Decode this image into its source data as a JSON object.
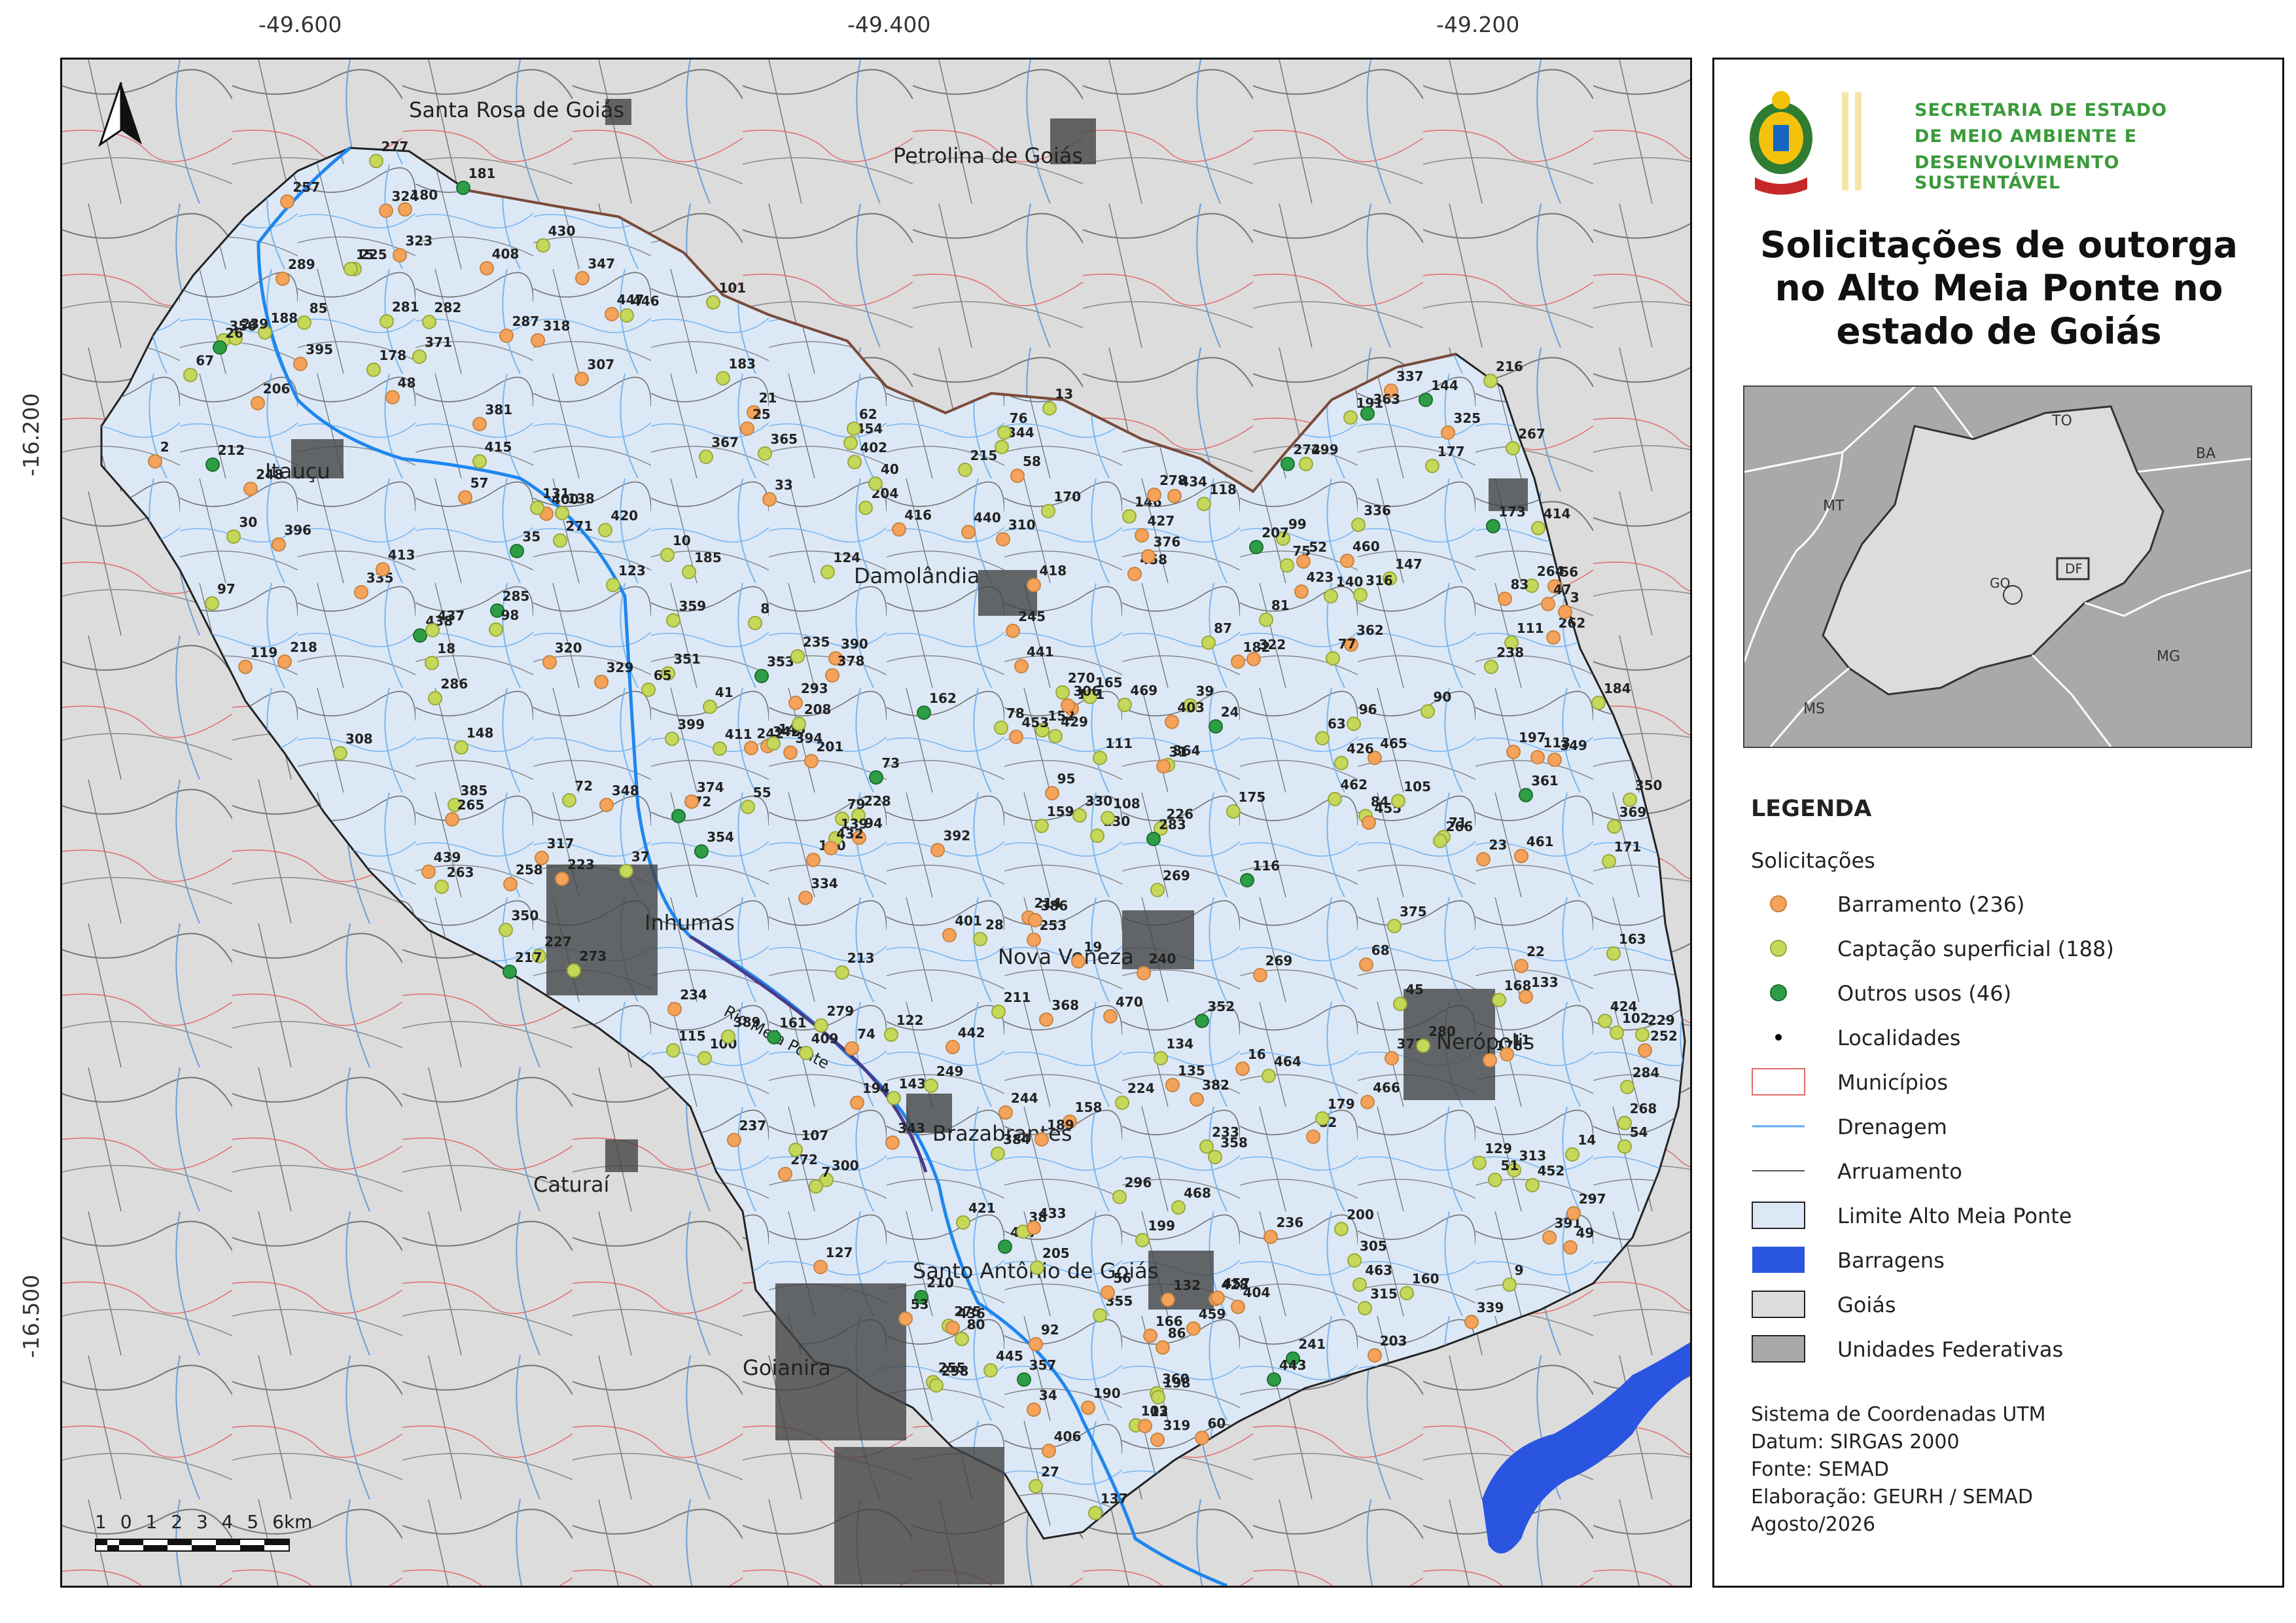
{
  "map": {
    "longitude_ticks": [
      "-49.600",
      "-49.400",
      "-49.200"
    ],
    "latitude_ticks": [
      "-16.200",
      "-16.500"
    ],
    "north_arrow": "north-arrow-icon",
    "scale_bar": {
      "labels": [
        "1",
        "0",
        "1",
        "2",
        "3",
        "4",
        "5",
        "6"
      ],
      "unit": "km"
    },
    "river_label": "Rio Meia Ponte",
    "localities": [
      "Santa Rosa de Goiás",
      "Petrolina de Goiás",
      "Itauçu",
      "Damolândia",
      "Inhumas",
      "Nova Veneza",
      "Nerópolis",
      "Brazabrantes",
      "Caturaí",
      "Santo Antônio de Goiás",
      "Goianira"
    ],
    "colors": {
      "barramento": "#f5a25a",
      "captacao_superficial": "#c6d85a",
      "outros_usos": "#2e9e46",
      "basin_fill": "#dce8f5",
      "outside_fill": "#dcdcdc",
      "drainage": "#5fa8f0",
      "reservoir": "#2a55e0",
      "municipal_border": "#e36a6a"
    }
  },
  "org": {
    "line1": "SECRETARIA DE ESTADO",
    "line2": "DE MEIO AMBIENTE E",
    "line3": "DESENVOLVIMENTO SUSTENTÁVEL",
    "emblem": "goias-coat-of-arms-icon"
  },
  "title": {
    "line1": "Solicitações de outorga",
    "line2": "no Alto Meia Ponte no",
    "line3": "estado de Goiás"
  },
  "inset": {
    "labels": [
      "TO",
      "BA",
      "MT",
      "GO",
      "DF",
      "MG",
      "MS"
    ]
  },
  "legend": {
    "title": "LEGENDA",
    "subtitle": "Solicitações",
    "items": [
      {
        "label": "Barramento (236)",
        "symbol": "point-orange"
      },
      {
        "label": "Captação superficial (188)",
        "symbol": "point-yellowgreen"
      },
      {
        "label": "Outros usos (46)",
        "symbol": "point-green"
      },
      {
        "label": "Localidades",
        "symbol": "point-black-small"
      },
      {
        "label": "Municípios",
        "symbol": "box-red-outline"
      },
      {
        "label": "Drenagem",
        "symbol": "line-blue"
      },
      {
        "label": "Arruamento",
        "symbol": "line-gray"
      },
      {
        "label": "Limite Alto Meia Ponte",
        "symbol": "box-lightblue"
      },
      {
        "label": "Barragens",
        "symbol": "box-blue"
      },
      {
        "label": "Goiás",
        "symbol": "box-lightgray"
      },
      {
        "label": "Unidades Federativas",
        "symbol": "box-darkgray"
      }
    ]
  },
  "credits": {
    "line1": "Sistema de Coordenadas UTM",
    "line2": "Datum: SIRGAS 2000",
    "line3": "Fonte: SEMAD",
    "line4": "Elaboração: GEURH / SEMAD",
    "line5": "Agosto/2026"
  },
  "points": [
    {
      "id": "458",
      "t": "b"
    },
    {
      "id": "135",
      "t": "b"
    },
    {
      "id": "428",
      "t": "b"
    },
    {
      "id": "81",
      "t": "c"
    },
    {
      "id": "191",
      "t": "c"
    },
    {
      "id": "58",
      "t": "b"
    },
    {
      "id": "339",
      "t": "b"
    },
    {
      "id": "322",
      "t": "b"
    },
    {
      "id": "320",
      "t": "b"
    },
    {
      "id": "342",
      "t": "b"
    },
    {
      "id": "337",
      "t": "b"
    },
    {
      "id": "335",
      "t": "b"
    },
    {
      "id": "354",
      "t": "o"
    },
    {
      "id": "350",
      "t": "c"
    },
    {
      "id": "274",
      "t": "o"
    },
    {
      "id": "147",
      "t": "c"
    },
    {
      "id": "275",
      "t": "c"
    },
    {
      "id": "39",
      "t": "c"
    },
    {
      "id": "118",
      "t": "c"
    },
    {
      "id": "41",
      "t": "c"
    },
    {
      "id": "287",
      "t": "b"
    },
    {
      "id": "271",
      "t": "c"
    },
    {
      "id": "365",
      "t": "c"
    },
    {
      "id": "84",
      "t": "c"
    },
    {
      "id": "436",
      "t": "b"
    },
    {
      "id": "158",
      "t": "b"
    },
    {
      "id": "150",
      "t": "b"
    },
    {
      "id": "376",
      "t": "b"
    },
    {
      "id": "439",
      "t": "b"
    },
    {
      "id": "133",
      "t": "b"
    },
    {
      "id": "469",
      "t": "c"
    },
    {
      "id": "466",
      "t": "b"
    },
    {
      "id": "86",
      "t": "b"
    },
    {
      "id": "244",
      "t": "b"
    },
    {
      "id": "248",
      "t": "b"
    },
    {
      "id": "127",
      "t": "b"
    },
    {
      "id": "242",
      "t": "b"
    },
    {
      "id": "457",
      "t": "b"
    },
    {
      "id": "92",
      "t": "b"
    },
    {
      "id": "258",
      "t": "b"
    },
    {
      "id": "224",
      "t": "c"
    },
    {
      "id": "226",
      "t": "c"
    },
    {
      "id": "103",
      "t": "c"
    },
    {
      "id": "344",
      "t": "c"
    },
    {
      "id": "364",
      "t": "c"
    },
    {
      "id": "351",
      "t": "c"
    },
    {
      "id": "285",
      "t": "o"
    },
    {
      "id": "268",
      "t": "c"
    },
    {
      "id": "210",
      "t": "o"
    },
    {
      "id": "316",
      "t": "c"
    },
    {
      "id": "228",
      "t": "c"
    },
    {
      "id": "270",
      "t": "c"
    },
    {
      "id": "188",
      "t": "c"
    },
    {
      "id": "85",
      "t": "c"
    },
    {
      "id": "82",
      "t": "b"
    },
    {
      "id": "87",
      "t": "c"
    },
    {
      "id": "385",
      "t": "c"
    },
    {
      "id": "56",
      "t": "b"
    },
    {
      "id": "57",
      "t": "b"
    },
    {
      "id": "223",
      "t": "b"
    },
    {
      "id": "116",
      "t": "o"
    },
    {
      "id": "382",
      "t": "b"
    },
    {
      "id": "318",
      "t": "b"
    },
    {
      "id": "390",
      "t": "b"
    },
    {
      "id": "352",
      "t": "o"
    },
    {
      "id": "245",
      "t": "b"
    },
    {
      "id": "394",
      "t": "b"
    },
    {
      "id": "418",
      "t": "b"
    },
    {
      "id": "121",
      "t": "b"
    },
    {
      "id": "173",
      "t": "o"
    },
    {
      "id": "353",
      "t": "o"
    },
    {
      "id": "462",
      "t": "c"
    },
    {
      "id": "360",
      "t": "c"
    },
    {
      "id": "368",
      "t": "b"
    },
    {
      "id": "452",
      "t": "c"
    },
    {
      "id": "255",
      "t": "c"
    },
    {
      "id": "282",
      "t": "c"
    },
    {
      "id": "336",
      "t": "c"
    },
    {
      "id": "179",
      "t": "c"
    },
    {
      "id": "160",
      "t": "c"
    },
    {
      "id": "299",
      "t": "c"
    },
    {
      "id": "225",
      "t": "c"
    },
    {
      "id": "98",
      "t": "c"
    },
    {
      "id": "94",
      "t": "b"
    },
    {
      "id": "97",
      "t": "c"
    },
    {
      "id": "190",
      "t": "b"
    },
    {
      "id": "180",
      "t": "b"
    },
    {
      "id": "122",
      "t": "c"
    },
    {
      "id": "465",
      "t": "b"
    },
    {
      "id": "470",
      "t": "b"
    },
    {
      "id": "447",
      "t": "b"
    },
    {
      "id": "214",
      "t": "b"
    },
    {
      "id": "63",
      "t": "c"
    },
    {
      "id": "305",
      "t": "c"
    },
    {
      "id": "381",
      "t": "b"
    },
    {
      "id": "319",
      "t": "b"
    },
    {
      "id": "55",
      "t": "c"
    },
    {
      "id": "284",
      "t": "c"
    },
    {
      "id": "194",
      "t": "b"
    },
    {
      "id": "392",
      "t": "b"
    },
    {
      "id": "233",
      "t": "c"
    },
    {
      "id": "138",
      "t": "c"
    },
    {
      "id": "67",
      "t": "c"
    },
    {
      "id": "71",
      "t": "c"
    },
    {
      "id": "68",
      "t": "b"
    },
    {
      "id": "404",
      "t": "b"
    },
    {
      "id": "252",
      "t": "b"
    },
    {
      "id": "362",
      "t": "b"
    },
    {
      "id": "283",
      "t": "o"
    },
    {
      "id": "361",
      "t": "o"
    },
    {
      "id": "395",
      "t": "b"
    },
    {
      "id": "349",
      "t": "b"
    },
    {
      "id": "137",
      "t": "c"
    },
    {
      "id": "200",
      "t": "c"
    },
    {
      "id": "367",
      "t": "c"
    },
    {
      "id": "146",
      "t": "c"
    },
    {
      "id": "15",
      "t": "c"
    },
    {
      "id": "253",
      "t": "b"
    },
    {
      "id": "400",
      "t": "b"
    },
    {
      "id": "206",
      "t": "b"
    },
    {
      "id": "396",
      "t": "b"
    },
    {
      "id": "403",
      "t": "b"
    },
    {
      "id": "373",
      "t": "b"
    },
    {
      "id": "265",
      "t": "b"
    },
    {
      "id": "329",
      "t": "b"
    },
    {
      "id": "145",
      "t": "c"
    },
    {
      "id": "363",
      "t": "o"
    },
    {
      "id": "212",
      "t": "o"
    },
    {
      "id": "391",
      "t": "b"
    },
    {
      "id": "347",
      "t": "b"
    },
    {
      "id": "115",
      "t": "c"
    },
    {
      "id": "73",
      "t": "o"
    },
    {
      "id": "74",
      "t": "b"
    },
    {
      "id": "445",
      "t": "c"
    },
    {
      "id": "241",
      "t": "o"
    },
    {
      "id": "172",
      "t": "o"
    },
    {
      "id": "348",
      "t": "b"
    },
    {
      "id": "455",
      "t": "b"
    },
    {
      "id": "369",
      "t": "c"
    },
    {
      "id": "411",
      "t": "c"
    },
    {
      "id": "375",
      "t": "c"
    },
    {
      "id": "189",
      "t": "b"
    },
    {
      "id": "72",
      "t": "c"
    },
    {
      "id": "430",
      "t": "c"
    },
    {
      "id": "277",
      "t": "c"
    },
    {
      "id": "75",
      "t": "c"
    },
    {
      "id": "267",
      "t": "c"
    },
    {
      "id": "148",
      "t": "c"
    },
    {
      "id": "286",
      "t": "c"
    },
    {
      "id": "175",
      "t": "c"
    },
    {
      "id": "464",
      "t": "c"
    },
    {
      "id": "60",
      "t": "b"
    },
    {
      "id": "423",
      "t": "b"
    },
    {
      "id": "170",
      "t": "c"
    },
    {
      "id": "171",
      "t": "c"
    },
    {
      "id": "463",
      "t": "c"
    },
    {
      "id": "300",
      "t": "c"
    },
    {
      "id": "101",
      "t": "c"
    },
    {
      "id": "374",
      "t": "b"
    },
    {
      "id": "467",
      "t": "o"
    },
    {
      "id": "359",
      "t": "c"
    },
    {
      "id": "356",
      "t": "c"
    },
    {
      "id": "357",
      "t": "o"
    },
    {
      "id": "201",
      "t": "b"
    },
    {
      "id": "264",
      "t": "c"
    },
    {
      "id": "13",
      "t": "c"
    },
    {
      "id": "130",
      "t": "c"
    },
    {
      "id": "123",
      "t": "c"
    },
    {
      "id": "177",
      "t": "c"
    },
    {
      "id": "315",
      "t": "c"
    },
    {
      "id": "355",
      "t": "c"
    },
    {
      "id": "78",
      "t": "c"
    },
    {
      "id": "168",
      "t": "c"
    },
    {
      "id": "166",
      "t": "b"
    },
    {
      "id": "52",
      "t": "b"
    },
    {
      "id": "178",
      "t": "c"
    },
    {
      "id": "438",
      "t": "o"
    },
    {
      "id": "111",
      "t": "c"
    },
    {
      "id": "152",
      "t": "c"
    },
    {
      "id": "208",
      "t": "c"
    },
    {
      "id": "131",
      "t": "c"
    },
    {
      "id": "14",
      "t": "c"
    },
    {
      "id": "446",
      "t": "c"
    },
    {
      "id": "132",
      "t": "b"
    },
    {
      "id": "343",
      "t": "b"
    },
    {
      "id": "9",
      "t": "c"
    },
    {
      "id": "79",
      "t": "c"
    },
    {
      "id": "199",
      "t": "c"
    },
    {
      "id": "176",
      "t": "b"
    },
    {
      "id": "10",
      "t": "c"
    },
    {
      "id": "102",
      "t": "c"
    },
    {
      "id": "358",
      "t": "c"
    },
    {
      "id": "437",
      "t": "c"
    },
    {
      "id": "165",
      "t": "c"
    },
    {
      "id": "313",
      "t": "c"
    },
    {
      "id": "229",
      "t": "c"
    },
    {
      "id": "139",
      "t": "c"
    },
    {
      "id": "227",
      "t": "c"
    },
    {
      "id": "429",
      "t": "c"
    },
    {
      "id": "235",
      "t": "c"
    },
    {
      "id": "263",
      "t": "c"
    },
    {
      "id": "459",
      "t": "b"
    },
    {
      "id": "297",
      "t": "b"
    },
    {
      "id": "140",
      "t": "c"
    },
    {
      "id": "65",
      "t": "c"
    },
    {
      "id": "399",
      "t": "c"
    },
    {
      "id": "51",
      "t": "c"
    },
    {
      "id": "421",
      "t": "c"
    },
    {
      "id": "238",
      "t": "c"
    },
    {
      "id": "408",
      "t": "b"
    },
    {
      "id": "239",
      "t": "c"
    },
    {
      "id": "460",
      "t": "b"
    },
    {
      "id": "182",
      "t": "b"
    },
    {
      "id": "427",
      "t": "b"
    },
    {
      "id": "269",
      "t": "b"
    },
    {
      "id": "108",
      "t": "c"
    },
    {
      "id": "181",
      "t": "o"
    },
    {
      "id": "54",
      "t": "c"
    },
    {
      "id": "96",
      "t": "c"
    },
    {
      "id": "129",
      "t": "c"
    },
    {
      "id": "298",
      "t": "c"
    },
    {
      "id": "468",
      "t": "c"
    },
    {
      "id": "215",
      "t": "c"
    },
    {
      "id": "183",
      "t": "c"
    },
    {
      "id": "237",
      "t": "b"
    },
    {
      "id": "2",
      "t": "b"
    },
    {
      "id": "204",
      "t": "c"
    },
    {
      "id": "143",
      "t": "c"
    },
    {
      "id": "217",
      "t": "o"
    },
    {
      "id": "159",
      "t": "c"
    },
    {
      "id": "420",
      "t": "c"
    },
    {
      "id": "273",
      "t": "c"
    },
    {
      "id": "216",
      "t": "c"
    },
    {
      "id": "406",
      "t": "b"
    },
    {
      "id": "401",
      "t": "b"
    },
    {
      "id": "30",
      "t": "c"
    },
    {
      "id": "38",
      "t": "c"
    },
    {
      "id": "213",
      "t": "c"
    },
    {
      "id": "53",
      "t": "b"
    },
    {
      "id": "144",
      "t": "o"
    },
    {
      "id": "384",
      "t": "c"
    },
    {
      "id": "134",
      "t": "c"
    },
    {
      "id": "443",
      "t": "o"
    },
    {
      "id": "454",
      "t": "c"
    },
    {
      "id": "272",
      "t": "b"
    },
    {
      "id": "266",
      "t": "c"
    },
    {
      "id": "434",
      "t": "b"
    },
    {
      "id": "413",
      "t": "b"
    },
    {
      "id": "414",
      "t": "c"
    },
    {
      "id": "62",
      "t": "c"
    },
    {
      "id": "161",
      "t": "o"
    },
    {
      "id": "90",
      "t": "c"
    },
    {
      "id": "184",
      "t": "c"
    },
    {
      "id": "440",
      "t": "b"
    },
    {
      "id": "308",
      "t": "c"
    },
    {
      "id": "198",
      "t": "c"
    },
    {
      "id": "350b",
      "t": "c"
    },
    {
      "id": "100",
      "t": "c"
    },
    {
      "id": "325",
      "t": "b"
    },
    {
      "id": "324",
      "t": "b"
    },
    {
      "id": "124",
      "t": "c"
    },
    {
      "id": "49",
      "t": "b"
    },
    {
      "id": "47",
      "t": "b"
    },
    {
      "id": "371",
      "t": "c"
    },
    {
      "id": "280",
      "t": "c"
    },
    {
      "id": "7",
      "t": "c"
    },
    {
      "id": "205",
      "t": "c"
    },
    {
      "id": "453",
      "t": "b"
    },
    {
      "id": "307",
      "t": "b"
    },
    {
      "id": "12",
      "t": "b"
    },
    {
      "id": "306",
      "t": "b"
    },
    {
      "id": "48",
      "t": "b"
    },
    {
      "id": "8",
      "t": "c"
    },
    {
      "id": "99",
      "t": "c"
    },
    {
      "id": "240",
      "t": "b"
    },
    {
      "id": "323",
      "t": "b"
    },
    {
      "id": "317",
      "t": "b"
    },
    {
      "id": "11",
      "t": "b"
    },
    {
      "id": "33",
      "t": "b"
    },
    {
      "id": "34",
      "t": "b"
    },
    {
      "id": "236",
      "t": "b"
    },
    {
      "id": "416",
      "t": "b"
    },
    {
      "id": "310",
      "t": "b"
    },
    {
      "id": "211",
      "t": "c"
    },
    {
      "id": "83",
      "t": "b"
    },
    {
      "id": "378",
      "t": "b"
    },
    {
      "id": "19",
      "t": "b"
    },
    {
      "id": "21",
      "t": "b"
    },
    {
      "id": "389",
      "t": "c"
    },
    {
      "id": "424",
      "t": "c"
    },
    {
      "id": "442",
      "t": "b"
    },
    {
      "id": "441",
      "t": "b"
    },
    {
      "id": "432",
      "t": "b"
    },
    {
      "id": "257",
      "t": "b"
    },
    {
      "id": "249",
      "t": "c"
    },
    {
      "id": "330",
      "t": "c"
    },
    {
      "id": "16",
      "t": "b"
    },
    {
      "id": "31",
      "t": "b"
    },
    {
      "id": "111b",
      "t": "c"
    },
    {
      "id": "18",
      "t": "c"
    },
    {
      "id": "105",
      "t": "c"
    },
    {
      "id": "40",
      "t": "c"
    },
    {
      "id": "269b",
      "t": "c"
    },
    {
      "id": "162",
      "t": "o"
    },
    {
      "id": "296",
      "t": "c"
    },
    {
      "id": "386",
      "t": "b"
    },
    {
      "id": "262",
      "t": "b"
    },
    {
      "id": "76",
      "t": "c"
    },
    {
      "id": "28",
      "t": "c"
    },
    {
      "id": "37",
      "t": "c"
    },
    {
      "id": "45",
      "t": "c"
    },
    {
      "id": "426",
      "t": "c"
    },
    {
      "id": "433",
      "t": "b"
    },
    {
      "id": "35",
      "t": "o"
    },
    {
      "id": "218",
      "t": "b"
    },
    {
      "id": "461",
      "t": "b"
    },
    {
      "id": "3",
      "t": "b"
    },
    {
      "id": "56b",
      "t": "b"
    },
    {
      "id": "113",
      "t": "b"
    },
    {
      "id": "22",
      "t": "b"
    },
    {
      "id": "24",
      "t": "o"
    },
    {
      "id": "279",
      "t": "c"
    },
    {
      "id": "278",
      "t": "b"
    },
    {
      "id": "289",
      "t": "b"
    },
    {
      "id": "293",
      "t": "b"
    },
    {
      "id": "119",
      "t": "b"
    },
    {
      "id": "26",
      "t": "o"
    },
    {
      "id": "27",
      "t": "c"
    },
    {
      "id": "207",
      "t": "o"
    },
    {
      "id": "80",
      "t": "c"
    },
    {
      "id": "402",
      "t": "c"
    },
    {
      "id": "415",
      "t": "c"
    },
    {
      "id": "234",
      "t": "b"
    },
    {
      "id": "197",
      "t": "b"
    },
    {
      "id": "334",
      "t": "b"
    },
    {
      "id": "23",
      "t": "b"
    },
    {
      "id": "77",
      "t": "c"
    },
    {
      "id": "281",
      "t": "c"
    },
    {
      "id": "107",
      "t": "c"
    },
    {
      "id": "95",
      "t": "b"
    },
    {
      "id": "203",
      "t": "b"
    },
    {
      "id": "25",
      "t": "b"
    },
    {
      "id": "409",
      "t": "c"
    },
    {
      "id": "163",
      "t": "c"
    },
    {
      "id": "185",
      "t": "c"
    }
  ]
}
